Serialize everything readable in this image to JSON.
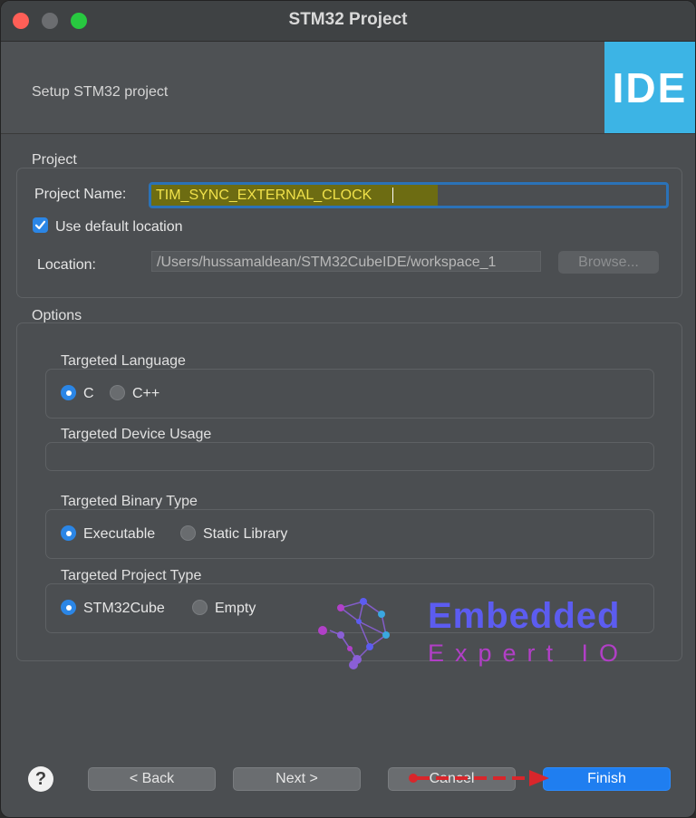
{
  "window": {
    "title": "STM32 Project",
    "subtitle": "Setup STM32 project",
    "logo_text": "IDE"
  },
  "project": {
    "section_label": "Project",
    "name_label": "Project Name:",
    "name_value": "TIM_SYNC_EXTERNAL_CLOCK",
    "default_location_label": "Use default location",
    "default_location_checked": true,
    "location_label": "Location:",
    "location_value": "/Users/hussamaldean/STM32CubeIDE/workspace_1",
    "browse_label": "Browse..."
  },
  "options": {
    "section_label": "Options",
    "language": {
      "label": "Targeted Language",
      "choices": [
        "C",
        "C++"
      ],
      "selected": "C"
    },
    "device_usage": {
      "label": "Targeted Device Usage"
    },
    "binary_type": {
      "label": "Targeted Binary Type",
      "choices": [
        "Executable",
        "Static Library"
      ],
      "selected": "Executable"
    },
    "project_type": {
      "label": "Targeted Project Type",
      "choices": [
        "STM32Cube",
        "Empty"
      ],
      "selected": "STM32Cube"
    }
  },
  "watermark": {
    "line1": "Embedded",
    "line2": "Expert IO"
  },
  "buttons": {
    "help": "?",
    "back": "< Back",
    "next": "Next >",
    "cancel": "Cancel",
    "finish": "Finish"
  },
  "colors": {
    "accent": "#2b86e6",
    "focus_ring": "#2b72b7",
    "logo_bg": "#3cb4e5",
    "selection_bg": "#6d6c12",
    "selection_text": "#f0e14a",
    "arrow": "#d9262b"
  }
}
